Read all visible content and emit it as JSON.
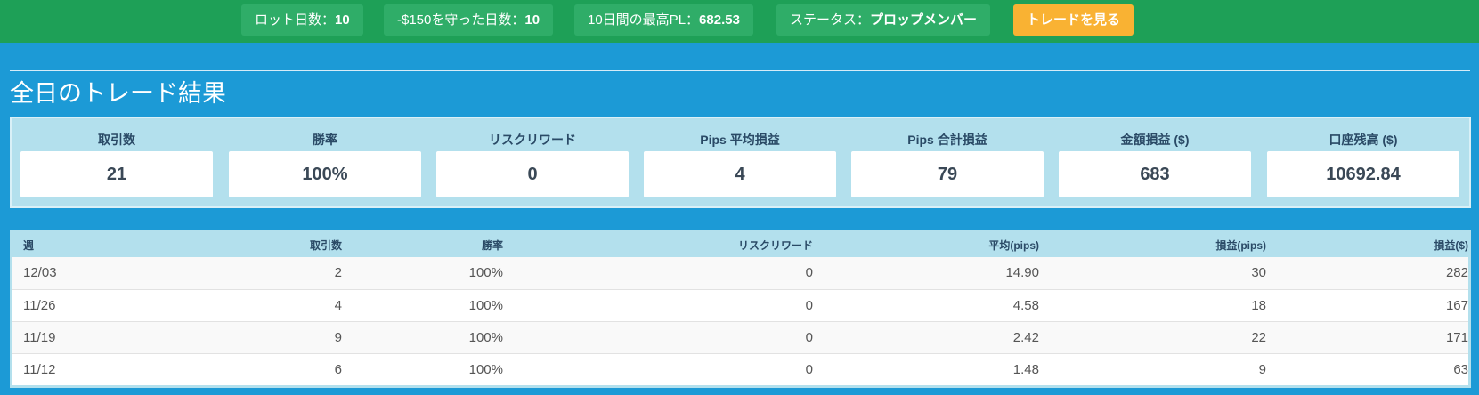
{
  "topbar": {
    "lot_days_label": "ロット日数：",
    "lot_days_value": "10",
    "kept_days_label": "-$150を守った日数：",
    "kept_days_value": "10",
    "best_pl_label": "10日間の最高PL：",
    "best_pl_value": "682.53",
    "status_label": "ステータス：",
    "status_value": "プロップメンバー",
    "cta_label": "トレードを見る"
  },
  "page": {
    "title": "全日のトレード結果"
  },
  "stats": [
    {
      "label": "取引数",
      "value": "21"
    },
    {
      "label": "勝率",
      "value": "100%"
    },
    {
      "label": "リスクリワード",
      "value": "0"
    },
    {
      "label": "Pips 平均損益",
      "value": "4"
    },
    {
      "label": "Pips 合計損益",
      "value": "79"
    },
    {
      "label": "金額損益 ($)",
      "value": "683"
    },
    {
      "label": "口座残高 ($)",
      "value": "10692.84"
    }
  ],
  "table": {
    "headers": [
      "週",
      "取引数",
      "勝率",
      "リスクリワード",
      "平均(pips)",
      "損益(pips)",
      "損益($)"
    ],
    "rows": [
      [
        "12/03",
        "2",
        "100%",
        "0",
        "14.90",
        "30",
        "282"
      ],
      [
        "11/26",
        "4",
        "100%",
        "0",
        "4.58",
        "18",
        "167"
      ],
      [
        "11/19",
        "9",
        "100%",
        "0",
        "2.42",
        "22",
        "171"
      ],
      [
        "11/12",
        "6",
        "100%",
        "0",
        "1.48",
        "9",
        "63"
      ]
    ]
  },
  "colors": {
    "background": "#1c9ad6",
    "topbar": "#1ea057",
    "pill": "#2fad68",
    "cta": "#f9b233",
    "panel": "#b3e0ed"
  }
}
